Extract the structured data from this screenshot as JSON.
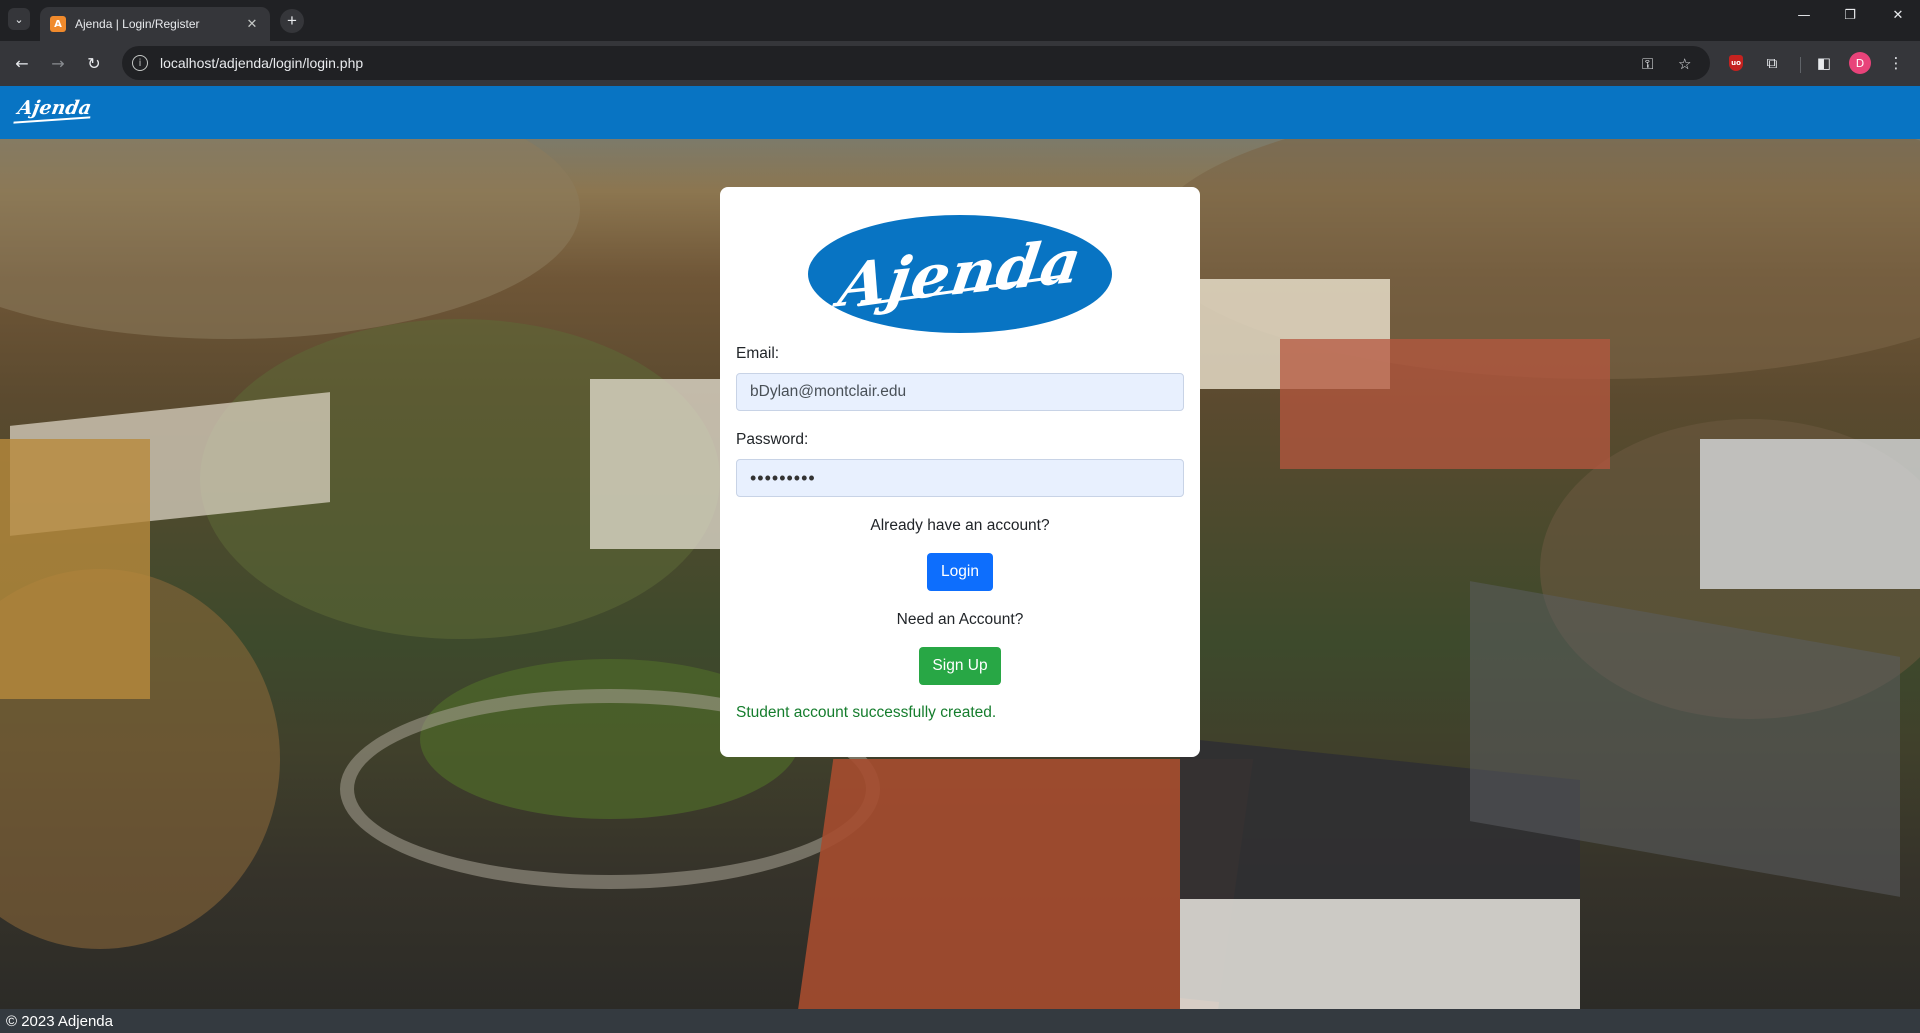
{
  "browser": {
    "tab_title": "Ajenda | Login/Register",
    "tab_close": "✕",
    "new_tab": "+",
    "tab_search": "⌄",
    "url": "localhost/adjenda/login/login.php",
    "nav": {
      "back": "←",
      "forward": "→",
      "reload": "↻"
    },
    "window": {
      "minimize": "—",
      "restore": "❐",
      "close": "✕"
    },
    "profile_initial": "D"
  },
  "navbar": {
    "brand": "Ajenda"
  },
  "login": {
    "logo_text": "Ajenda",
    "email_label": "Email:",
    "email_value": "bDylan@montclair.edu",
    "password_label": "Password:",
    "password_value": "•••••••••",
    "have_account_text": "Already have an account?",
    "login_button": "Login",
    "need_account_text": "Need an Account?",
    "signup_button": "Sign Up",
    "success_message": "Student account successfully created."
  },
  "footer": {
    "text": "© 2023 Adjenda"
  },
  "colors": {
    "brand_blue": "#0874c3",
    "login_button": "#0d6efd",
    "signup_button": "#28a745",
    "success_text": "#157d2d",
    "footer_bg": "#343a40"
  }
}
